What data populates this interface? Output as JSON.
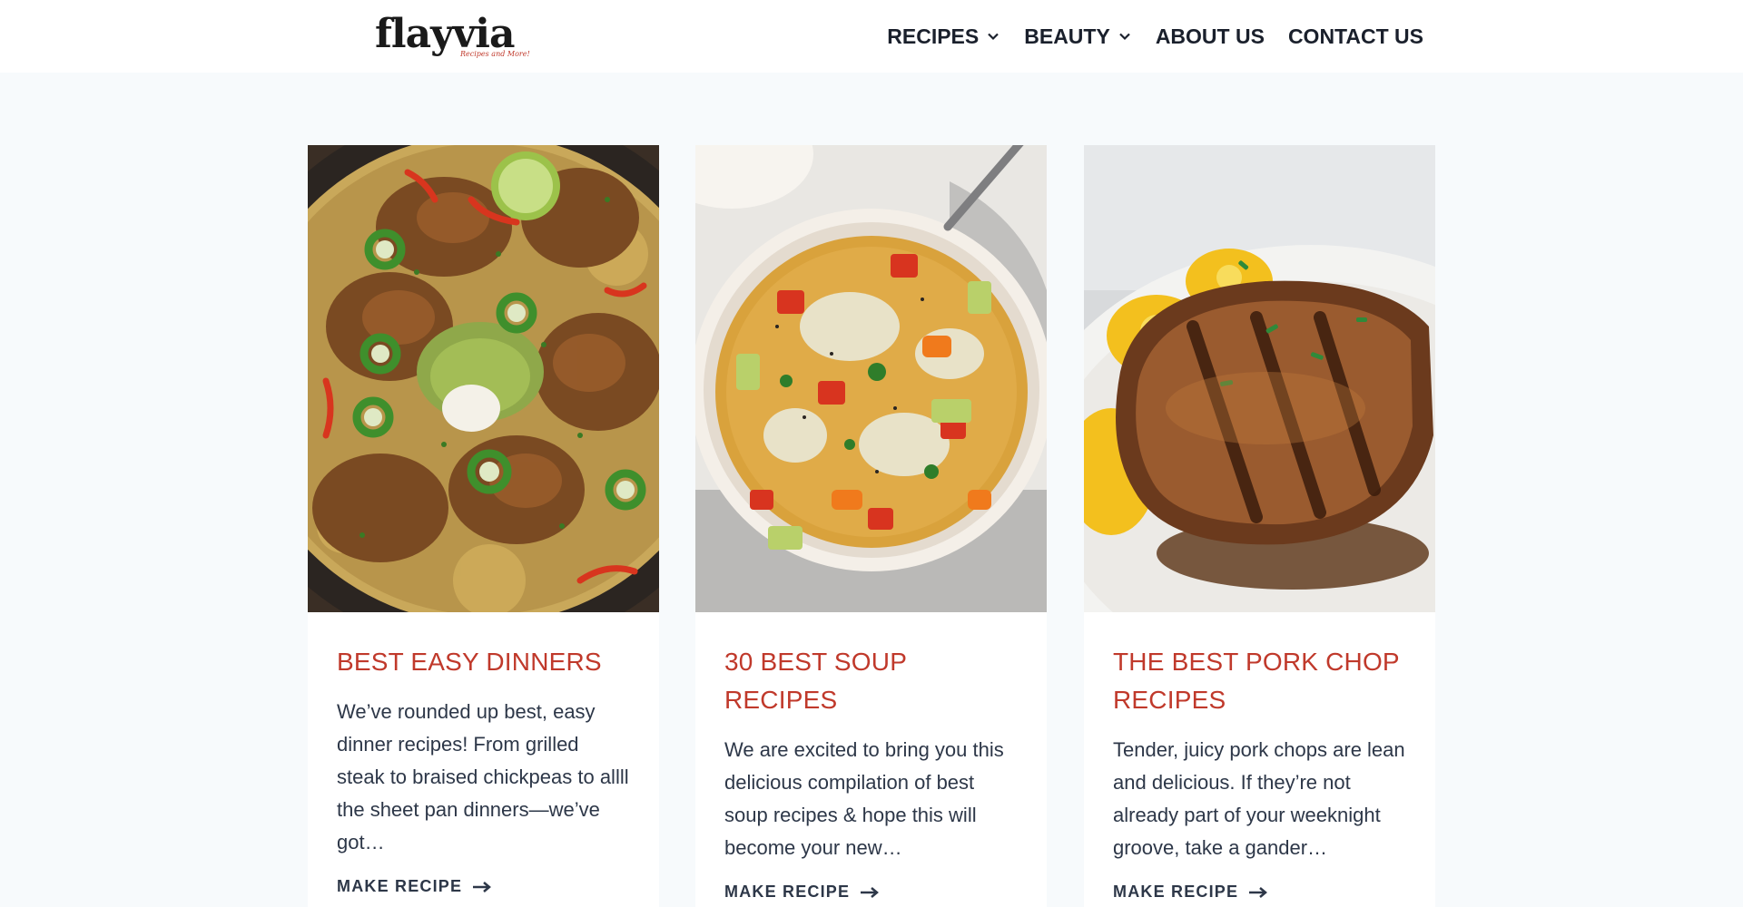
{
  "header": {
    "logo": {
      "word": "flayvia",
      "tagline": "Recipes and More!"
    },
    "nav": [
      {
        "label": "RECIPES",
        "has_dropdown": true
      },
      {
        "label": "BEAUTY",
        "has_dropdown": true
      },
      {
        "label": "ABOUT US",
        "has_dropdown": false
      },
      {
        "label": "CONTACT US",
        "has_dropdown": false
      }
    ]
  },
  "cards": [
    {
      "title": "BEST EASY DINNERS",
      "excerpt": "We’ve rounded up best, easy dinner recipes! From grilled steak to braised chickpeas to allll the sheet pan dinners—we’ve got…",
      "cta": "MAKE RECIPE",
      "image_subject": "chicken-rice-skillet"
    },
    {
      "title": "30 BEST SOUP RECIPES",
      "excerpt": "We are excited to bring you this delicious compilation of best soup recipes & hope this will become your new…",
      "cta": "MAKE RECIPE",
      "image_subject": "vegetable-soup-bowl"
    },
    {
      "title": "THE BEST PORK CHOP RECIPES",
      "excerpt": "Tender, juicy pork chops are lean and delicious. If they’re not already part of your weeknight groove, take a gander…",
      "cta": "MAKE RECIPE",
      "image_subject": "grilled-pork-chop"
    }
  ],
  "colors": {
    "page_bg": "#f7fafc",
    "header_bg": "#ffffff",
    "title_accent": "#c0392b",
    "text": "#2d3748",
    "nav_text": "#1a202c"
  }
}
